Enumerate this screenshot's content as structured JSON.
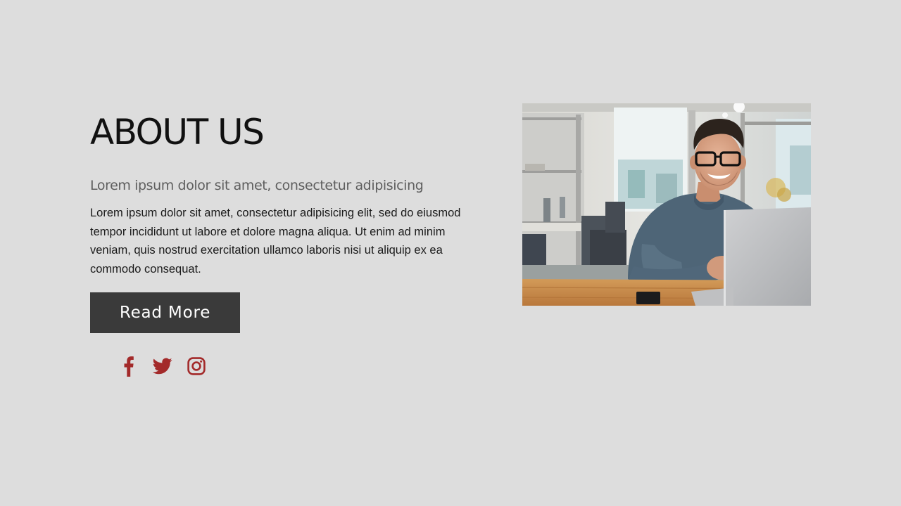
{
  "about": {
    "title": "ABOUT US",
    "subtitle": "Lorem ipsum dolor sit amet, consectetur adipisicing",
    "body": "Lorem ipsum dolor sit amet, consectetur adipisicing elit, sed do eiusmod tempor incididunt ut labore et dolore magna aliqua. Ut enim ad minim veniam, quis nostrud exercitation ullamco laboris nisi ut aliquip ex ea commodo consequat.",
    "button_label": "Read More"
  },
  "social": {
    "icons": [
      "facebook-icon",
      "twitter-icon",
      "instagram-icon"
    ],
    "color": "#a32a2a"
  },
  "photo": {
    "subject": "smiling man with glasses at laptop in office"
  },
  "colors": {
    "background": "#dddddd",
    "button_bg": "#3a3a3a",
    "button_text": "#ffffff",
    "accent": "#a32a2a"
  }
}
